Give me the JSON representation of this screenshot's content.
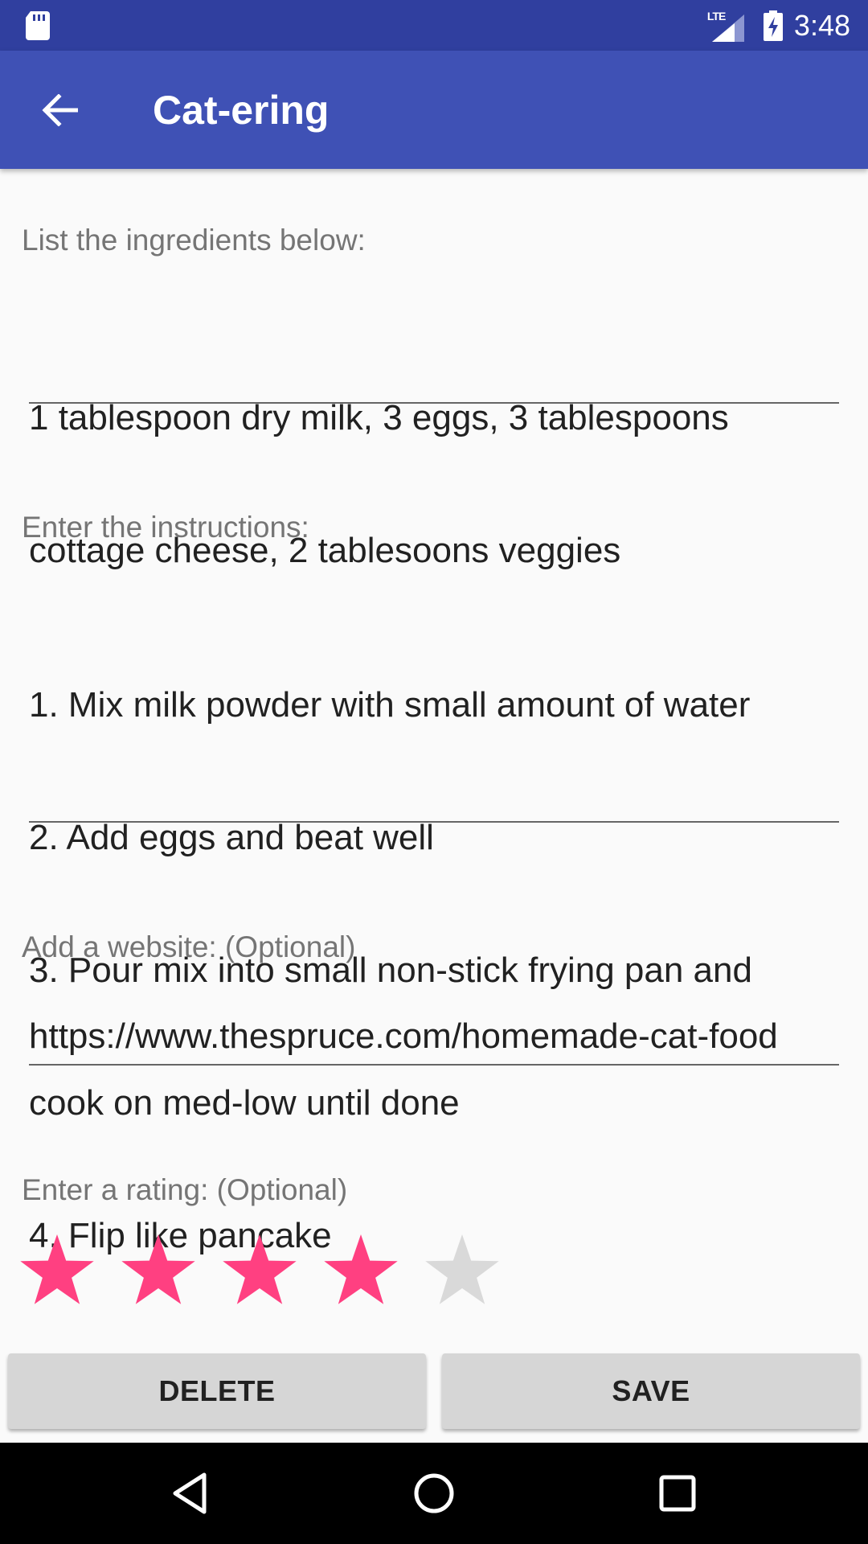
{
  "status_bar": {
    "network_label": "LTE",
    "time": "3:48",
    "icons": [
      "sd-card-icon",
      "signal-icon",
      "battery-charging-icon"
    ]
  },
  "app_bar": {
    "title": "Cat-ering",
    "back_icon": "arrow-back-icon"
  },
  "form": {
    "ingredients": {
      "label": "List the ingredients below:",
      "lines": [
        "1 tablespoon dry milk, 3 eggs, 3 tablespoons",
        "cottage cheese, 2 tablesoons veggies"
      ]
    },
    "instructions": {
      "label": "Enter the instructions:",
      "lines": [
        "1. Mix milk powder with small amount of water",
        "2. Add eggs and beat well",
        "3. Pour mix into small non-stick frying pan and",
        "cook on med-low until done",
        "4. Flip like pancake"
      ]
    },
    "website": {
      "label": "Add a website: (Optional)",
      "value": "https://www.thespruce.com/homemade-cat-food"
    },
    "rating": {
      "label": "Enter a rating: (Optional)",
      "value": 4,
      "max": 5,
      "active_color": "#ff4081",
      "inactive_color": "#d9d9d9"
    }
  },
  "buttons": {
    "delete_label": "DELETE",
    "save_label": "SAVE"
  },
  "nav_bar": {
    "icons": [
      "nav-back-icon",
      "nav-home-icon",
      "nav-recents-icon"
    ]
  },
  "colors": {
    "status_bar": "#303f9f",
    "app_bar": "#3f51b5",
    "accent": "#ff4081"
  }
}
